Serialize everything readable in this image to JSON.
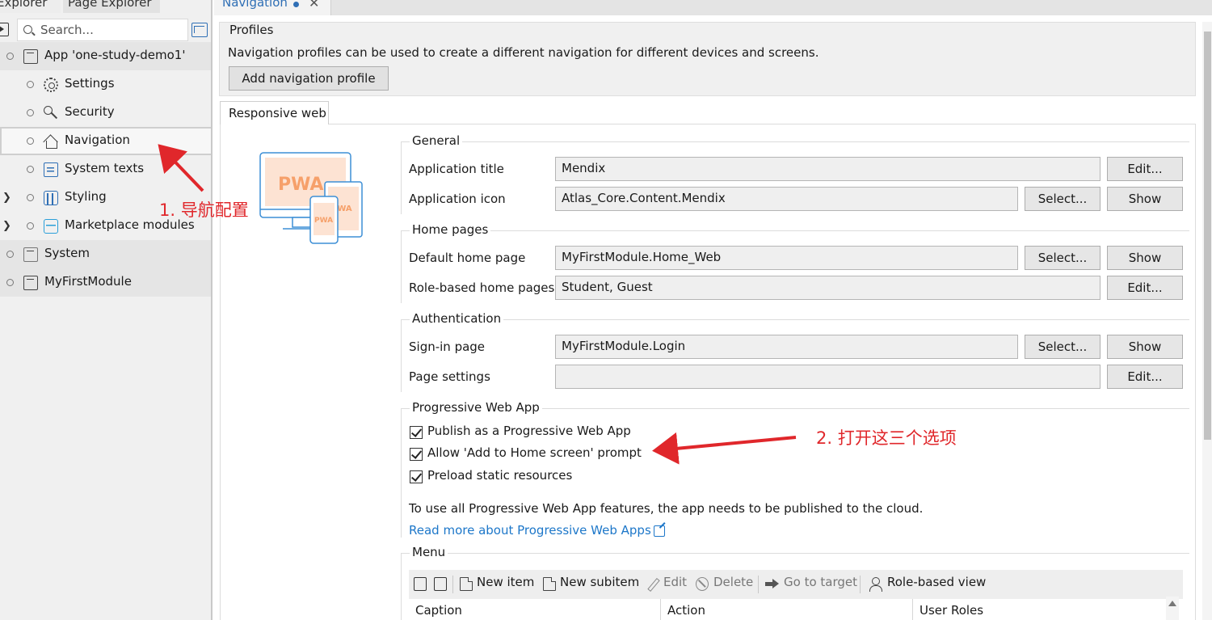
{
  "left_pane": {
    "tabs": [
      "Explorer",
      "Page Explorer"
    ],
    "search_placeholder": "Search...",
    "tree": [
      {
        "label": "App 'one-study-demo1'",
        "icon": "box-icon"
      },
      {
        "label": "Settings",
        "icon": "gear-icon"
      },
      {
        "label": "Security",
        "icon": "key-icon"
      },
      {
        "label": "Navigation",
        "icon": "home-icon"
      },
      {
        "label": "System texts",
        "icon": "texts-icon"
      },
      {
        "label": "Styling",
        "icon": "styling-icon"
      },
      {
        "label": "Marketplace modules",
        "icon": "marketplace-icon"
      },
      {
        "label": "System",
        "icon": "module-icon"
      },
      {
        "label": "MyFirstModule",
        "icon": "module-icon"
      }
    ]
  },
  "annotations": {
    "step1": "1. 导航配置",
    "step2": "2. 打开这三个选项",
    "color": "#e0272b"
  },
  "editor": {
    "tab_title": "Navigation",
    "profiles": {
      "title": "Profiles",
      "description": "Navigation profiles can be used to create a different navigation for different devices and screens.",
      "add_button": "Add navigation profile"
    },
    "profile_tab": "Responsive web",
    "illustration_text": "PWA",
    "general": {
      "title": "General",
      "app_title_label": "Application title",
      "app_title_value": "Mendix",
      "app_icon_label": "Application icon",
      "app_icon_value": "Atlas_Core.Content.Mendix"
    },
    "home_pages": {
      "title": "Home pages",
      "default_label": "Default home page",
      "default_value": "MyFirstModule.Home_Web",
      "role_label": "Role-based home pages",
      "role_value": "Student, Guest"
    },
    "authentication": {
      "title": "Authentication",
      "signin_label": "Sign-in page",
      "signin_value": "MyFirstModule.Login",
      "page_settings_label": "Page settings",
      "page_settings_value": ""
    },
    "pwa": {
      "title": "Progressive Web App",
      "options": [
        {
          "label": "Publish as a Progressive Web App",
          "checked": true
        },
        {
          "label": "Allow 'Add to Home screen' prompt",
          "checked": true
        },
        {
          "label": "Preload static resources",
          "checked": true
        }
      ],
      "note": "To use all Progressive Web App features, the app needs to be published to the cloud.",
      "link": "Read more about Progressive Web Apps"
    },
    "menu": {
      "title": "Menu",
      "toolbar": {
        "new_item": "New item",
        "new_subitem": "New subitem",
        "edit": "Edit",
        "delete": "Delete",
        "go_to_target": "Go to target",
        "role_based_view": "Role-based view"
      },
      "columns": [
        "Caption",
        "Action",
        "User Roles"
      ]
    },
    "buttons": {
      "edit": "Edit...",
      "select": "Select...",
      "show": "Show"
    }
  },
  "colors": {
    "accent_blue": "#2f6fb5",
    "link_blue": "#1d77c9",
    "pwa_orange": "#f6a06a"
  }
}
